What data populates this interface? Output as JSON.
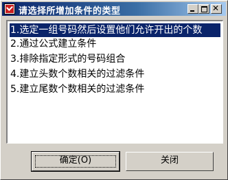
{
  "window": {
    "title": "请选择所增加条件的类型",
    "app_icon": "check-badge-icon",
    "controls": {
      "minimize": "minimize-icon",
      "maximize": "maximize-icon",
      "close_glyph": "✕"
    }
  },
  "list": {
    "selected_index": 0,
    "items": [
      {
        "label": "1.选定一组号码然后设置他们允许开出的个数"
      },
      {
        "label": "2.通过公式建立条件"
      },
      {
        "label": "3.排除指定形式的号码组合"
      },
      {
        "label": "4.建立头数个数相关的过滤条件"
      },
      {
        "label": "5.建立尾数个数相关的过滤条件"
      }
    ]
  },
  "buttons": {
    "ok_label": "确定(O)",
    "close_label": "关闭"
  },
  "colors": {
    "titlebar": "#0a246a",
    "selection": "#0a246a",
    "face": "#d4d0c8"
  }
}
